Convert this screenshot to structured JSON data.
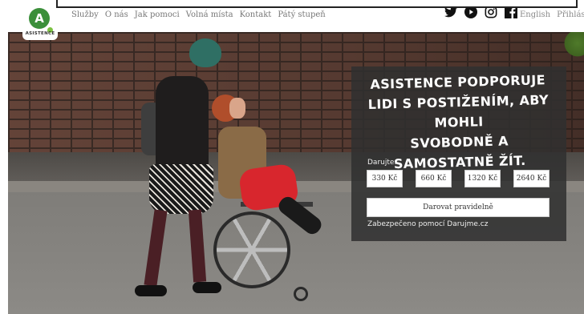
{
  "logo": {
    "letter": "A",
    "text": "ASISTENCE"
  },
  "nav": {
    "items": [
      "Služby",
      "O nás",
      "Jak pomoci",
      "Volná místa",
      "Kontakt",
      "Pátý stupeň"
    ]
  },
  "social": {
    "icons": [
      "twitter-icon",
      "youtube-icon",
      "instagram-icon",
      "facebook-icon"
    ]
  },
  "lang": {
    "english": "English",
    "login": "Přihlásit"
  },
  "hero": {
    "headline": [
      "ASISTENCE PODPORUJE",
      "LIDI S POSTIŽENÍM, ABY MOHLI",
      "SVOBODNĚ A SAMOSTATNĚ ŽÍT."
    ],
    "donate_label": "Darujte:",
    "amounts": [
      "330 Kč",
      "660 Kč",
      "1320 Kč",
      "2640 Kč"
    ],
    "regular_button": "Darovat pravidelně",
    "secured": "Zabezpečeno pomocí Darujme.cz"
  },
  "colors": {
    "brand_green": "#3b8f3a",
    "panel_bg": "#303030",
    "accent_red": "#d8262d"
  }
}
